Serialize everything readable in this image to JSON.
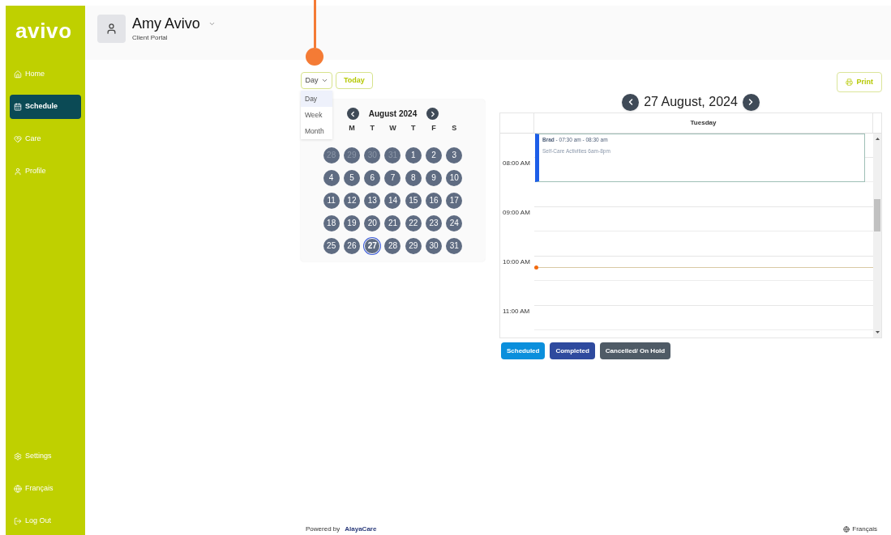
{
  "sidebar": {
    "logo": "avivo",
    "nav": [
      {
        "label": "Home",
        "selected": false
      },
      {
        "label": "Schedule",
        "selected": true
      },
      {
        "label": "Care",
        "selected": false
      },
      {
        "label": "Profile",
        "selected": false
      }
    ],
    "bottom": [
      {
        "label": "Settings"
      },
      {
        "label": "Français"
      },
      {
        "label": "Log Out"
      }
    ]
  },
  "header": {
    "name": "Amy Avivo",
    "subtitle": "Client Portal"
  },
  "view_select": {
    "value": "Day",
    "options": [
      {
        "label": "Day",
        "selected": true
      },
      {
        "label": "Week",
        "selected": false
      },
      {
        "label": "Month",
        "selected": false
      }
    ]
  },
  "today_button": "Today",
  "print_button": "Print",
  "mini_calendar": {
    "month": "August 2024",
    "weekdays": [
      "M",
      "T",
      "W",
      "T",
      "F",
      "S"
    ],
    "days": [
      {
        "label": "28",
        "muted": true,
        "selected": false
      },
      {
        "label": "29",
        "muted": true,
        "selected": false
      },
      {
        "label": "30",
        "muted": true,
        "selected": false
      },
      {
        "label": "31",
        "muted": true,
        "selected": false
      },
      {
        "label": "1",
        "muted": false,
        "selected": false
      },
      {
        "label": "2",
        "muted": false,
        "selected": false
      },
      {
        "label": "3",
        "muted": false,
        "selected": false
      },
      {
        "label": "4",
        "muted": false,
        "selected": false
      },
      {
        "label": "5",
        "muted": false,
        "selected": false
      },
      {
        "label": "6",
        "muted": false,
        "selected": false
      },
      {
        "label": "7",
        "muted": false,
        "selected": false
      },
      {
        "label": "8",
        "muted": false,
        "selected": false
      },
      {
        "label": "9",
        "muted": false,
        "selected": false
      },
      {
        "label": "10",
        "muted": false,
        "selected": false
      },
      {
        "label": "11",
        "muted": false,
        "selected": false
      },
      {
        "label": "12",
        "muted": false,
        "selected": false
      },
      {
        "label": "13",
        "muted": false,
        "selected": false
      },
      {
        "label": "14",
        "muted": false,
        "selected": false
      },
      {
        "label": "15",
        "muted": false,
        "selected": false
      },
      {
        "label": "16",
        "muted": false,
        "selected": false
      },
      {
        "label": "17",
        "muted": false,
        "selected": false
      },
      {
        "label": "18",
        "muted": false,
        "selected": false
      },
      {
        "label": "19",
        "muted": false,
        "selected": false
      },
      {
        "label": "20",
        "muted": false,
        "selected": false
      },
      {
        "label": "21",
        "muted": false,
        "selected": false
      },
      {
        "label": "22",
        "muted": false,
        "selected": false
      },
      {
        "label": "23",
        "muted": false,
        "selected": false
      },
      {
        "label": "24",
        "muted": false,
        "selected": false
      },
      {
        "label": "25",
        "muted": false,
        "selected": false
      },
      {
        "label": "26",
        "muted": false,
        "selected": false
      },
      {
        "label": "27",
        "muted": false,
        "selected": true
      },
      {
        "label": "28",
        "muted": false,
        "selected": false
      },
      {
        "label": "29",
        "muted": false,
        "selected": false
      },
      {
        "label": "30",
        "muted": false,
        "selected": false
      },
      {
        "label": "31",
        "muted": false,
        "selected": false
      }
    ]
  },
  "day_view": {
    "title": "27 August, 2024",
    "column": "Tuesday",
    "times": [
      "08:00 AM",
      "09:00 AM",
      "10:00 AM",
      "11:00 AM"
    ],
    "events": [
      {
        "heading": "**Brad** - 07:30 am - 08:30 am",
        "description": "Self-Care Activities 6am-8pm",
        "color": "#1d5ee8"
      }
    ]
  },
  "legend": [
    {
      "label": "Scheduled",
      "color": "#0b8fdc"
    },
    {
      "label": "Completed",
      "color": "#2e4a9e"
    },
    {
      "label": "Cancelled/ On Hold",
      "color": "#4f5b66"
    }
  ],
  "footer": {
    "powered_by": "Powered by",
    "brand": "AlayaCare",
    "language": "Français"
  }
}
